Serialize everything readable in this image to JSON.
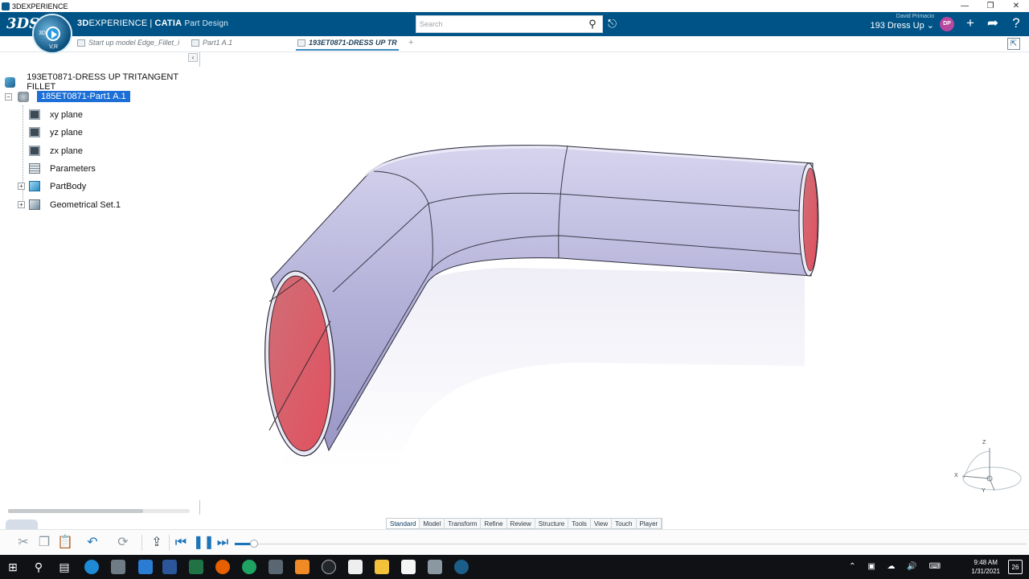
{
  "window": {
    "title": "3DEXPERIENCE",
    "controls": [
      "—",
      "❐",
      "✕"
    ]
  },
  "header": {
    "brand_logo": "3DS",
    "compass_labels": [
      "3D",
      "V,R"
    ],
    "product_bold": "3D",
    "product_rest": "EXPERIENCE",
    "separator": "|",
    "product_catia": "CATIA",
    "app_name": "Part Design",
    "search_placeholder": "Search",
    "user_name": "David Primacio",
    "collab_space": "193 Dress Up",
    "avatar_initials": "DP",
    "colors": {
      "header_bg": "#005386",
      "selection": "#1b6fd6"
    }
  },
  "tabs": [
    {
      "label": "Start up model Edge_Fillet_i",
      "active": false
    },
    {
      "label": "Part1 A.1",
      "active": false
    },
    {
      "label": "193ET0871-DRESS UP TR",
      "active": true
    }
  ],
  "tree": {
    "root_label": "193ET0871-DRESS UP TRITANGENT FILLET",
    "part_label": "185ET0871-Part1 A.1",
    "items": [
      {
        "label": "xy plane",
        "icon": "plane-icon",
        "expandable": false
      },
      {
        "label": "yz plane",
        "icon": "plane-icon",
        "expandable": false
      },
      {
        "label": "zx plane",
        "icon": "plane-icon",
        "expandable": false
      },
      {
        "label": "Parameters",
        "icon": "parameters-icon",
        "expandable": false
      },
      {
        "label": "PartBody",
        "icon": "partbody-icon",
        "expandable": true
      },
      {
        "label": "Geometrical Set.1",
        "icon": "geometrical-set-icon",
        "expandable": true
      }
    ]
  },
  "viewport": {
    "model": "bent tube with oval cross-section",
    "colors": {
      "body": "#b4b1d8",
      "face": "#d5636e"
    },
    "axis_labels": {
      "z": "Z",
      "x": "X",
      "y": "Y"
    }
  },
  "action_tabs": [
    "Standard",
    "Model",
    "Transform",
    "Refine",
    "Review",
    "Structure",
    "Tools",
    "View",
    "Touch",
    "Player"
  ],
  "action_tab_active": "Standard",
  "taskbar": {
    "time": "9:48 AM",
    "date": "1/31/2021",
    "notification_count": "26"
  }
}
